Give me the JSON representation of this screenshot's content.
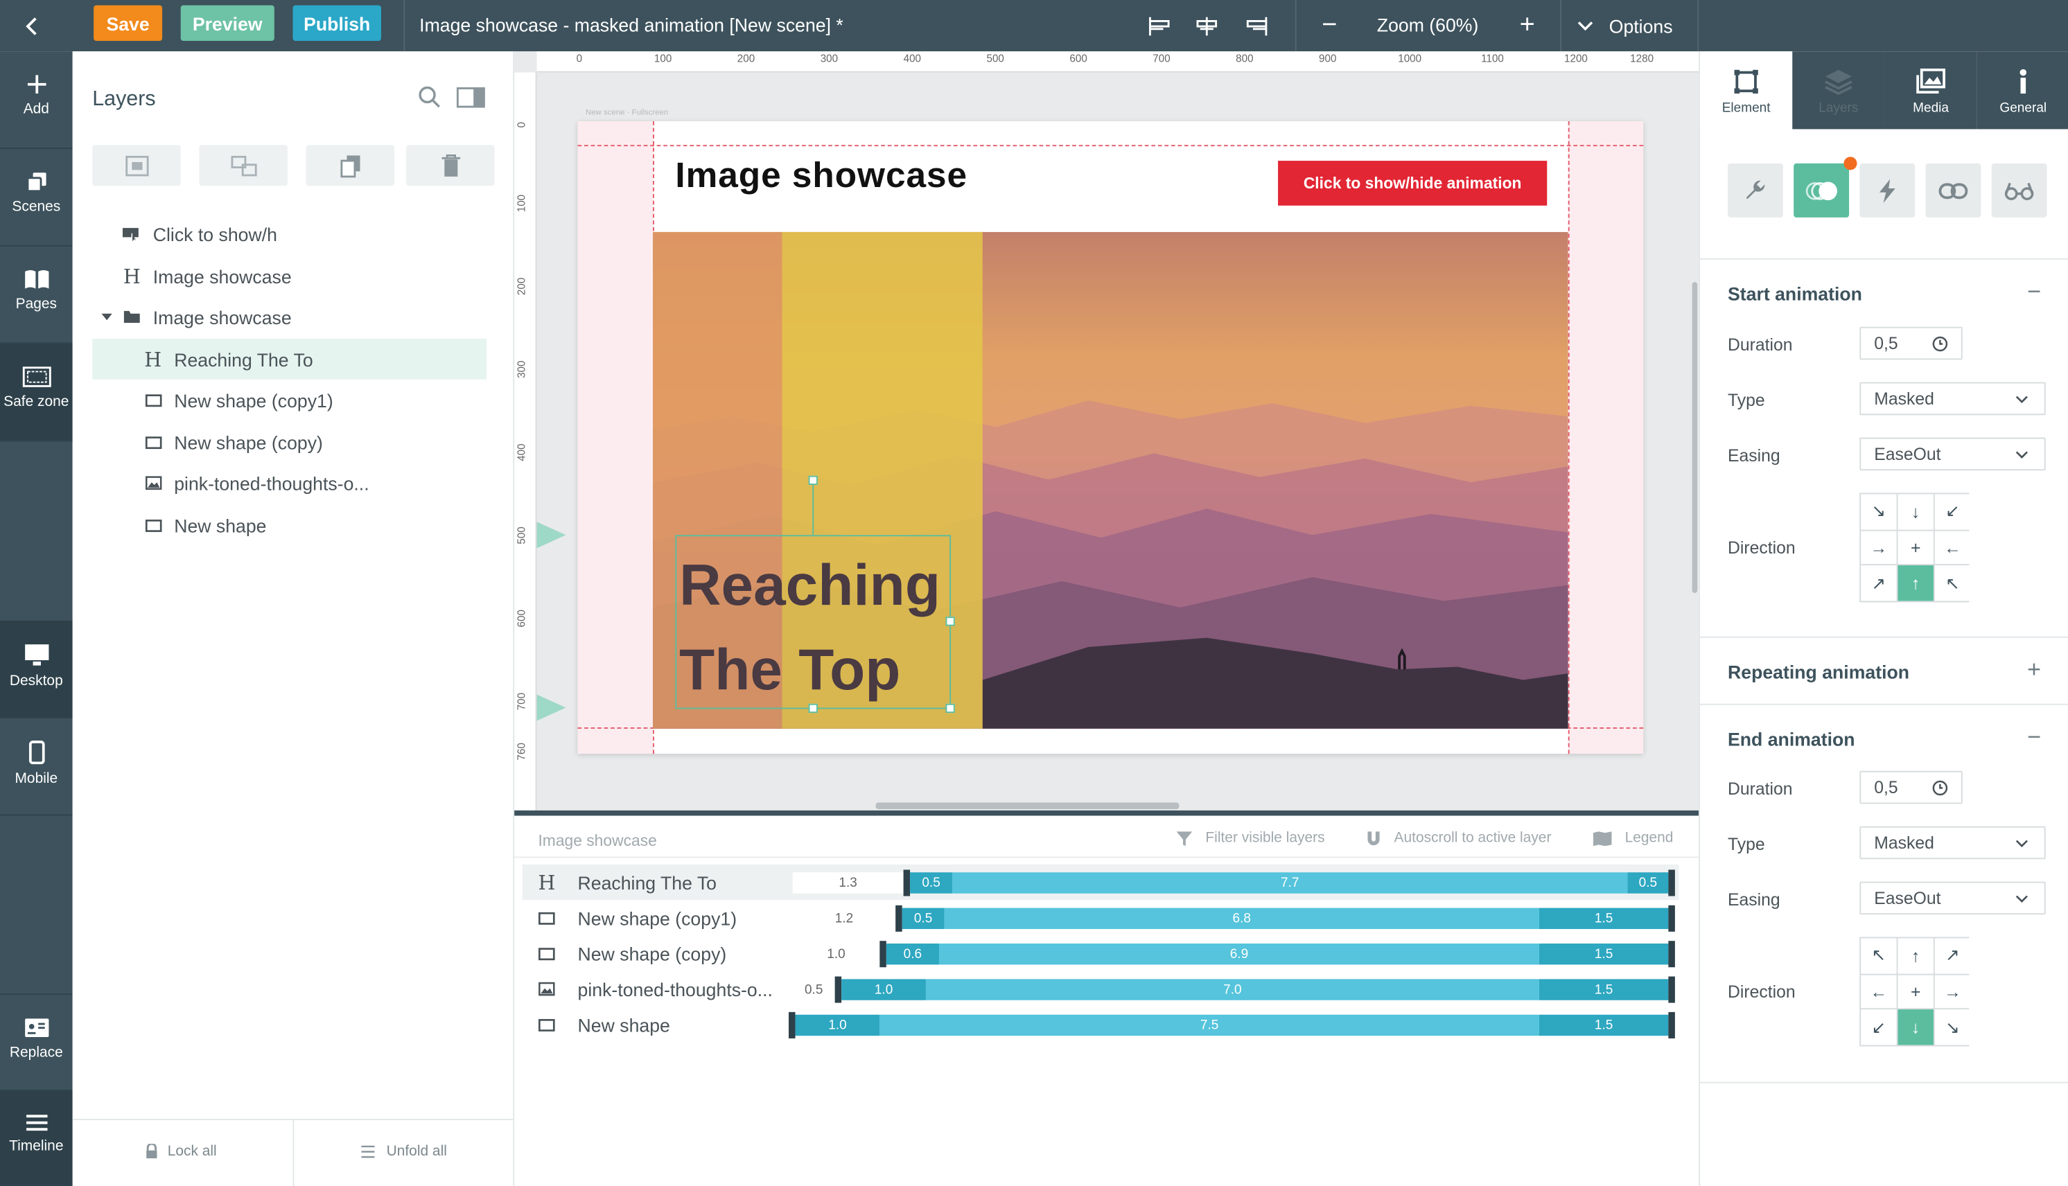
{
  "topbar": {
    "save": "Save",
    "preview": "Preview",
    "publish": "Publish",
    "title": "Image showcase - masked animation [New scene] *",
    "zoom": "Zoom (60%)",
    "options": "Options",
    "colors": {
      "bar": "#3d525c",
      "save": "#f28a1c",
      "preview": "#6ec2a5",
      "publish": "#2ba7c8"
    }
  },
  "rail": {
    "add": "Add",
    "scenes": "Scenes",
    "pages": "Pages",
    "safe_zone": "Safe zone",
    "desktop": "Desktop",
    "mobile": "Mobile",
    "replace": "Replace",
    "timeline": "Timeline"
  },
  "layers": {
    "title": "Layers",
    "items": [
      {
        "label": "Click to show/h",
        "icon": "cursor-button-icon"
      },
      {
        "label": "Image showcase",
        "icon": "heading-icon"
      },
      {
        "label": "Image showcase",
        "icon": "folder-icon"
      },
      {
        "label": "Reaching The To",
        "icon": "heading-icon"
      },
      {
        "label": "New shape (copy1)",
        "icon": "rectangle-icon"
      },
      {
        "label": "New shape (copy)",
        "icon": "rectangle-icon"
      },
      {
        "label": "pink-toned-thoughts-o...",
        "icon": "image-icon"
      },
      {
        "label": "New shape",
        "icon": "rectangle-icon"
      }
    ],
    "lock_all": "Lock all",
    "unfold_all": "Unfold all"
  },
  "canvas": {
    "scene_label": "New scene · Fullscreen",
    "heading": "Image showcase",
    "cta": "Click to show/hide animation",
    "text_line1": "Reaching",
    "text_line2": "The Top",
    "ruler_top": [
      "0",
      "100",
      "200",
      "300",
      "400",
      "500",
      "600",
      "700",
      "800",
      "900",
      "1000",
      "1100",
      "1200",
      "1280"
    ],
    "ruler_left": [
      "0",
      "100",
      "200",
      "300",
      "400",
      "500",
      "600",
      "700",
      "760"
    ]
  },
  "timeline": {
    "title": "Image showcase",
    "filter": "Filter visible layers",
    "autoscroll": "Autoscroll to active layer",
    "legend": "Legend",
    "rows": [
      {
        "label": "Reaching The To",
        "icon": "heading-icon",
        "delay": "1.3",
        "in": "0.5",
        "mid": "7.7",
        "out": "0.5"
      },
      {
        "label": "New shape (copy1)",
        "icon": "rectangle-icon",
        "delay": "1.2",
        "in": "0.5",
        "mid": "6.8",
        "out": "1.5"
      },
      {
        "label": "New shape (copy)",
        "icon": "rectangle-icon",
        "delay": "1.0",
        "in": "0.6",
        "mid": "6.9",
        "out": "1.5"
      },
      {
        "label": "pink-toned-thoughts-o...",
        "icon": "image-icon",
        "delay": "0.5",
        "in": "1.0",
        "mid": "7.0",
        "out": "1.5"
      },
      {
        "label": "New shape",
        "icon": "rectangle-icon",
        "delay": "",
        "in": "1.0",
        "mid": "7.5",
        "out": "1.5"
      }
    ]
  },
  "rpanel": {
    "tabs": [
      "Element",
      "Layers",
      "Media",
      "General"
    ],
    "start": {
      "title": "Start animation",
      "duration_label": "Duration",
      "duration": "0,5",
      "type_label": "Type",
      "type": "Masked",
      "easing_label": "Easing",
      "easing": "EaseOut",
      "direction_label": "Direction"
    },
    "repeat": {
      "title": "Repeating animation"
    },
    "end": {
      "title": "End animation",
      "duration_label": "Duration",
      "duration": "0,5",
      "type_label": "Type",
      "type": "Masked",
      "easing_label": "Easing",
      "easing": "EaseOut",
      "direction_label": "Direction"
    },
    "start_dirs": [
      "↘",
      "↓",
      "↙",
      "→",
      "+",
      "←",
      "↗",
      "↑",
      "↖"
    ],
    "end_dirs": [
      "↖",
      "↑",
      "↗",
      "←",
      "+",
      "→",
      "↙",
      "↓",
      "↘"
    ]
  }
}
